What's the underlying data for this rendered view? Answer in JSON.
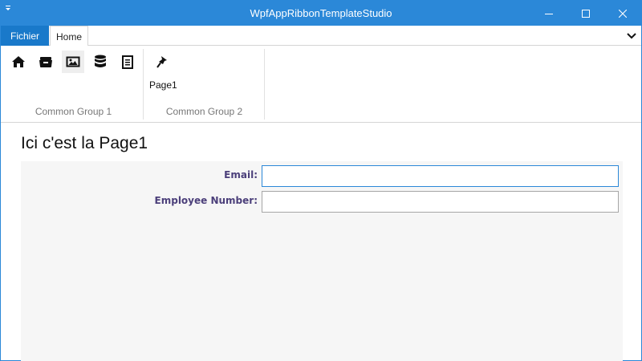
{
  "window": {
    "title": "WpfAppRibbonTemplateStudio"
  },
  "ribbon": {
    "tabs": [
      {
        "label": "Fichier",
        "selected": false
      },
      {
        "label": "Home",
        "selected": true
      }
    ],
    "groups": [
      {
        "label": "Common Group 1",
        "buttons": [
          {
            "icon": "home-icon"
          },
          {
            "icon": "archive-icon"
          },
          {
            "icon": "image-icon"
          },
          {
            "icon": "database-icon"
          },
          {
            "icon": "document-icon"
          }
        ]
      },
      {
        "label": "Common Group 2",
        "buttons": [
          {
            "icon": "pushpin-icon",
            "label": "Page1"
          }
        ]
      }
    ]
  },
  "page": {
    "title": "Ici c'est la Page1",
    "form": {
      "email_label": "Email:",
      "email_value": "",
      "employee_number_label": "Employee Number:",
      "employee_number_value": ""
    }
  },
  "colors": {
    "accent": "#2b88d8",
    "file_tab": "#1979ca",
    "label_text": "#4b3f7a",
    "form_background": "#f6f6f6"
  }
}
